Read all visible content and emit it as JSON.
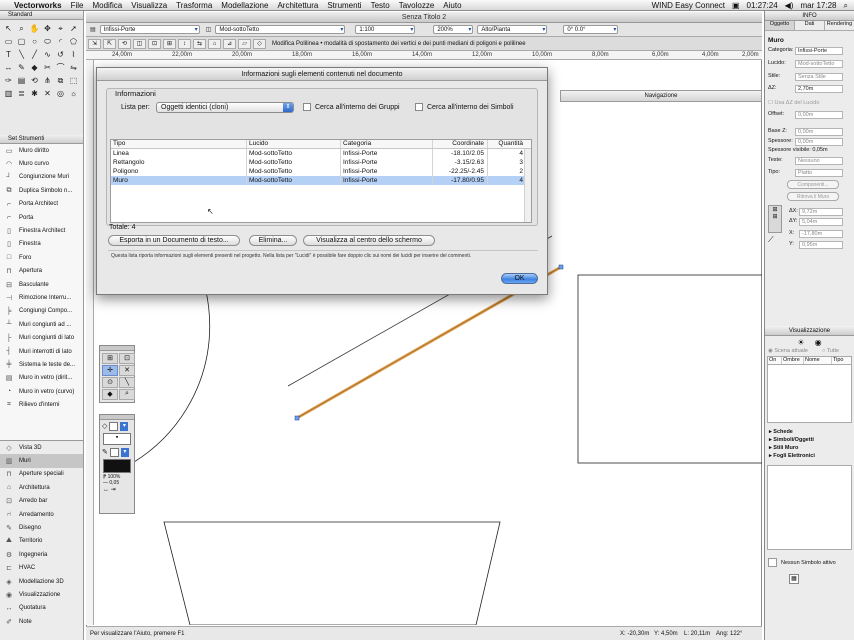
{
  "menubar": {
    "app": "Vectorworks",
    "menus": [
      "File",
      "Modifica",
      "Visualizza",
      "Trasforma",
      "Modellazione",
      "Architettura",
      "Strumenti",
      "Testo",
      "Tavolozze",
      "Aiuto"
    ],
    "right_app": "WIND Easy Connect",
    "time1": "01:27:24",
    "clock": "mar 17:28"
  },
  "tool_palette": {
    "title": "Standard"
  },
  "tool_set": {
    "title": "Set Strumenti",
    "items": [
      "Muro diritto",
      "Muro curvo",
      "Congiunzione Muri",
      "Duplica Simbolo n...",
      "Porta Architect",
      "Porta",
      "Finestra Architect",
      "Finestra",
      "Foro",
      "Apertura",
      "Basculante",
      "Rimozione Interru...",
      "Congiungi Compo...",
      "Muri congiunti ad ...",
      "Muri congiunti di lato",
      "Muri interrotti di lato",
      "Sistema le teste de...",
      "Muro in vetro (dirit...",
      "Muro in vetro (curvo)",
      "Rilievo d'interni"
    ]
  },
  "categories": {
    "items": [
      "Vista 3D",
      "Muri",
      "Aperture speciali",
      "Architettura",
      "Arredo bar",
      "Arredamento",
      "Disegno",
      "Territorio",
      "Ingegneria",
      "HVAC",
      "Modellazione 3D",
      "Visualizzazione",
      "Quotatura",
      "Note"
    ],
    "selected": "Muri"
  },
  "document": {
    "title": "Senza Titolo 2",
    "class_dd": "Infissi-Porte",
    "layer_dd": "Mod-sottoTetto",
    "scale_dd": "1:100",
    "zoom_dd": "200%",
    "view_dd": "Alto/Pianta",
    "angle_dd": "0°  0.0°",
    "mode_text": "Modifica Polilinea • modalità di spostamento dei vertici e dei punti mediani di poligoni e polilinee",
    "ruler_ticks": [
      "24,00m",
      "22,00m",
      "20,00m",
      "18,00m",
      "16,00m",
      "14,00m",
      "12,00m",
      "10,00m",
      "8,00m",
      "6,00m",
      "4,00m",
      "2,00m"
    ],
    "status_text": "Per visualizzare l'Aiuto, premere F1",
    "status_x": "X: -20,30m",
    "status_y": "Y: 4,50m",
    "status_l": "L: 20,11m",
    "status_ang": "Ang: 122°"
  },
  "navigation": {
    "title": "Navigazione"
  },
  "info_palette": {
    "title": "INFO",
    "tabs": [
      "Oggetto",
      "Dati",
      "Rendering"
    ],
    "object_type": "Muro",
    "fields": [
      {
        "label": "Categoria:",
        "value": "Infissi-Porte"
      },
      {
        "label": "Lucido:",
        "value": "Mod-sottoTetto"
      },
      {
        "label": "Stile:",
        "value": "Senza Stile"
      },
      {
        "label": "ΔZ:",
        "value": "2,70m"
      }
    ],
    "use_dz": "Usa ΔZ del Lucido",
    "offset_label": "Offset:",
    "offset_val": "0,00m",
    "base_z_label": "Base Z:",
    "base_z_val": "0,00m",
    "thickness_label": "Spessore:",
    "thickness_val": "0,00m",
    "visible_thickness": "Spessore visibile: 0,05m",
    "heads_label": "Teste:",
    "heads_val": "Nessuno",
    "type_label": "Tipo:",
    "type_val": "Piatto",
    "components_btn": "Componenti...",
    "wall_btn": "Ritrova il Muro",
    "dx_label": "ΔX:",
    "dx_val": "9,72m",
    "dy_label": "ΔY:",
    "dy_val": "5,04m",
    "x_label": "X:",
    "x_val": "-17,80m",
    "y_label": "Y:",
    "y_val": "0,95m"
  },
  "vis_palette": {
    "title": "Visualizzazione",
    "scene_label": "Scena attuale",
    "all_label": "Tutte",
    "columns": [
      "On",
      "Ombre",
      "Nome",
      "Tipo"
    ],
    "resources": [
      "Schede",
      "Simboli/Oggetti",
      "Stili Muro",
      "Fogli Elettronici"
    ],
    "no_symbol": "Nessun Simbolo attivo"
  },
  "dialog": {
    "title": "Informazioni sugli elementi contenuti nel documento",
    "group_label": "Informazioni",
    "list_label": "Lista per:",
    "list_value": "Oggetti identici (cloni)",
    "search_groups": "Cerca all'interno dei Gruppi",
    "search_symbols": "Cerca all'interno dei Simboli",
    "columns": [
      "Tipo",
      "Lucido",
      "Categoria",
      "Coordinate",
      "Quantità"
    ],
    "rows": [
      {
        "tipo": "Linea",
        "lucido": "Mod-sottoTetto",
        "categoria": "Infissi-Porte",
        "coord": "-18.10/2.05",
        "qty": "4"
      },
      {
        "tipo": "Rettangolo",
        "lucido": "Mod-sottoTetto",
        "categoria": "Infissi-Porte",
        "coord": "-3.15/2.63",
        "qty": "3"
      },
      {
        "tipo": "Poligono",
        "lucido": "Mod-sottoTetto",
        "categoria": "Infissi-Porte",
        "coord": "-22.25/-2.45",
        "qty": "2"
      },
      {
        "tipo": "Muro",
        "lucido": "Mod-sottoTetto",
        "categoria": "Infissi-Porte",
        "coord": "-17.80/0.95",
        "qty": "4"
      }
    ],
    "selected_row": 3,
    "total": "Totale: 4",
    "btn_export": "Esporta in un Documento di testo...",
    "btn_delete": "Elimina...",
    "btn_center": "Visualizza al centro dello schermo",
    "note": "Questa lista riporta informazioni sugli elementi presenti nel progetto. Nella lista per \"Lucidi\" è possibile fare doppio clic sui nomi dei lucidi per inserire dei commenti.",
    "ok": "OK"
  },
  "floating": {
    "zoom": "100%",
    "thickness": "0,05"
  }
}
